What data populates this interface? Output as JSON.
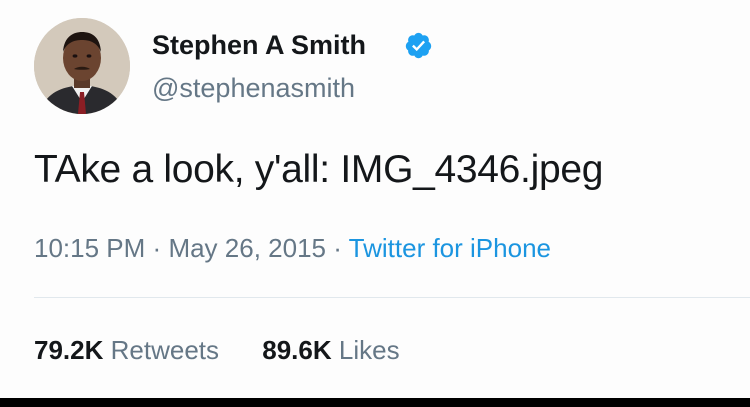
{
  "author": {
    "display_name": "Stephen A Smith",
    "handle": "@stephenasmith",
    "verified": true,
    "avatar_icon": "profile-photo"
  },
  "tweet": {
    "text": "TAke a look, y'all: IMG_4346.jpeg",
    "time": "10:15 PM",
    "date": "May 26, 2015",
    "separator": "·",
    "source": "Twitter for iPhone"
  },
  "stats": {
    "retweets_count": "79.2K",
    "retweets_label": "Retweets",
    "likes_count": "89.6K",
    "likes_label": "Likes"
  },
  "colors": {
    "text_primary": "#14171a",
    "text_secondary": "#657786",
    "link": "#1b95e0",
    "verified_badge": "#1da1f2",
    "divider": "#e1e8ed"
  }
}
